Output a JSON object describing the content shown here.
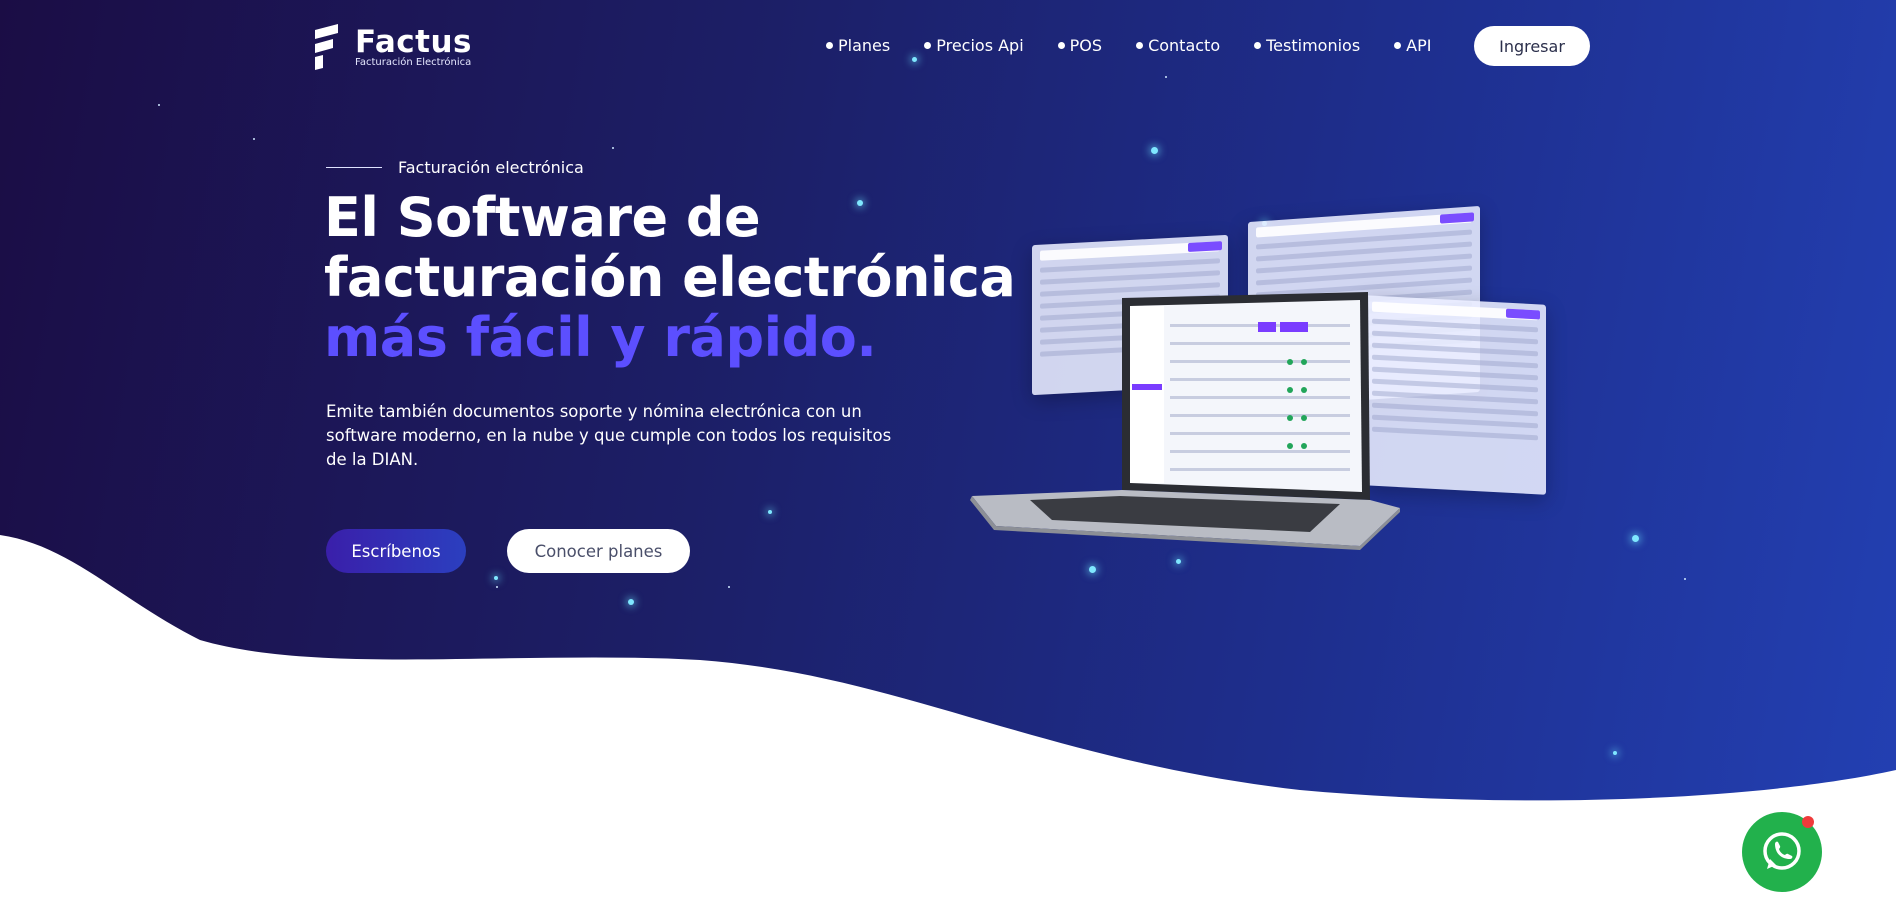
{
  "brand": {
    "name": "Factus",
    "tagline": "Facturación Electrónica"
  },
  "nav": {
    "items": [
      {
        "label": "Planes"
      },
      {
        "label": "Precios Api"
      },
      {
        "label": "POS"
      },
      {
        "label": "Contacto"
      },
      {
        "label": "Testimonios"
      },
      {
        "label": "API"
      }
    ],
    "login_label": "Ingresar"
  },
  "hero": {
    "eyebrow": "Facturación electrónica",
    "headline_line1": "El Software de",
    "headline_line2": "facturación electrónica",
    "headline_accent": "más fácil y rápido.",
    "description": "Emite también documentos soporte y nómina electrónica con un software moderno, en la nube y que cumple con todos los requisitos de la DIAN.",
    "primary_cta": "Escríbenos",
    "secondary_cta": "Conocer planes"
  },
  "colors": {
    "accent": "#5c4fff",
    "whatsapp": "#22b14c",
    "hero_start": "#1b0d45",
    "hero_end": "#2340b3"
  },
  "icons": {
    "logo": "factus-logo-icon",
    "whatsapp": "whatsapp-icon"
  }
}
